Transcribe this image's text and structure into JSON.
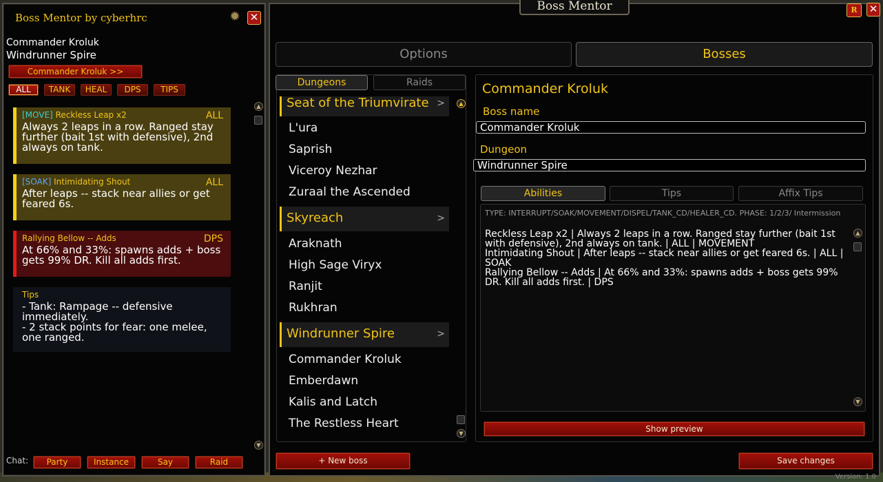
{
  "mentor": {
    "title": "Boss Mentor by cyberhrc",
    "boss": "Commander Kroluk",
    "dungeon": "Windrunner Spire",
    "boss_button": "Commander Kroluk  >>",
    "filters": [
      "ALL",
      "TANK",
      "HEAL",
      "DPS",
      "TIPS"
    ],
    "cards": [
      {
        "tag": "[MOVE]",
        "tag_color": "#3ccfcf",
        "name": "Reckless Leap x2",
        "audience": "ALL",
        "body": "Always 2 leaps in a row. Ranged stay further (bait 1st with defensive), 2nd always on tank."
      },
      {
        "tag": "[SOAK]",
        "tag_color": "#5aa8ff",
        "name": "Intimidating Shout",
        "audience": "ALL",
        "body": "After leaps -- stack near allies or get feared 6s."
      },
      {
        "tag": "",
        "tag_color": "#f1c419",
        "name": "Rallying Bellow -- Adds",
        "audience": "DPS",
        "body": "At 66% and 33%: spawns adds + boss gets 99% DR. Kill all adds first."
      },
      {
        "tag": "",
        "tag_color": "#f1c419",
        "name": "Tips",
        "audience": "",
        "body": "- Tank: Rampage -- defensive immediately.\n- 2 stack points for fear: one melee, one ranged."
      }
    ],
    "chat_label": "Chat:",
    "chat_buttons": [
      "Party",
      "Instance",
      "Say",
      "Raid"
    ]
  },
  "main": {
    "header": "Boss Mentor",
    "r_button": "R",
    "tabs": [
      "Options",
      "Bosses"
    ],
    "subtabs": [
      "Dungeons",
      "Raids"
    ],
    "groups": [
      {
        "name": "Seat of the Triumvirate",
        "bosses": [
          "L'ura",
          "Saprish",
          "Viceroy Nezhar",
          "Zuraal the Ascended"
        ]
      },
      {
        "name": "Skyreach",
        "bosses": [
          "Araknath",
          "High Sage Viryx",
          "Ranjit",
          "Rukhran"
        ]
      },
      {
        "name": "Windrunner Spire",
        "bosses": [
          "Commander Kroluk",
          "Emberdawn",
          "Kalis and Latch",
          "The Restless Heart"
        ]
      }
    ],
    "detail": {
      "title": "Commander Kroluk",
      "boss_name_label": "Boss name",
      "boss_name_value": "Commander Kroluk",
      "dungeon_label": "Dungeon",
      "dungeon_value": "Windrunner Spire",
      "tabs": [
        "Abilities",
        "Tips",
        "Affix Tips"
      ],
      "hint": "TYPE: INTERRUPT/SOAK/MOVEMENT/DISPEL/TANK_CD/HEALER_CD.  PHASE: 1/2/3/ Intermission",
      "lines": [
        "Reckless Leap x2 | Always 2 leaps in a row. Ranged stay further (bait 1st with defensive), 2nd always on tank. | ALL | MOVEMENT",
        "Intimidating Shout | After leaps -- stack near allies or get feared 6s. | ALL | SOAK",
        "Rallying Bellow -- Adds | At 66% and 33%: spawns adds + boss gets 99% DR. Kill all adds first. | DPS"
      ],
      "preview_button": "Show preview"
    },
    "new_boss_button": "+ New boss",
    "save_button": "Save changes",
    "version": "Version: 1.0"
  }
}
